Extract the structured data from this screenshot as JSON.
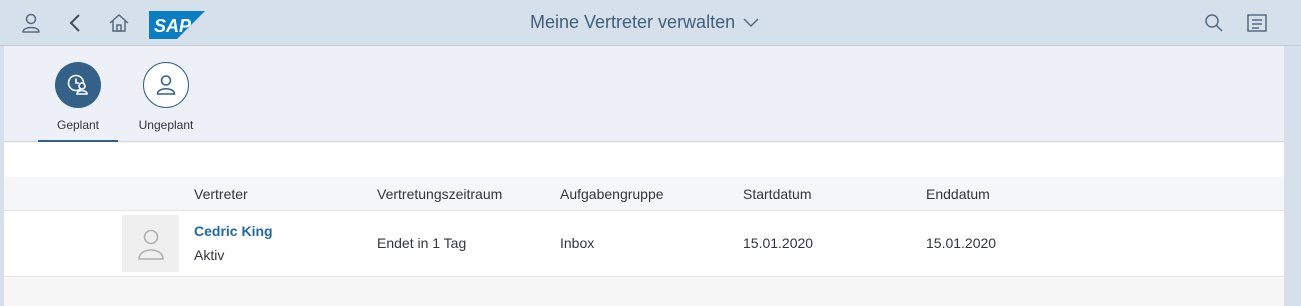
{
  "shell": {
    "logo_text": "SAP",
    "title": "Meine Vertreter verwalten",
    "icons": [
      "user-icon",
      "back-icon",
      "home-icon",
      "search-icon",
      "menu-icon"
    ]
  },
  "tabs": [
    {
      "label": "Geplant",
      "icon": "calendar-person-icon",
      "selected": true
    },
    {
      "label": "Ungeplant",
      "icon": "person-icon",
      "selected": false
    }
  ],
  "table": {
    "columns": [
      "Vertreter",
      "Vertretungszeitraum",
      "Aufgabengruppe",
      "Startdatum",
      "Enddatum"
    ],
    "rows": [
      {
        "name": "Cedric King",
        "status": "Aktiv",
        "zeitraum": "Endet in 1 Tag",
        "gruppe": "Inbox",
        "start": "15.01.2020",
        "ende": "15.01.2020"
      }
    ]
  },
  "colors": {
    "brand": "#1f6aa5",
    "tab_selected": "#346187",
    "shell": "#d6e0ea"
  }
}
